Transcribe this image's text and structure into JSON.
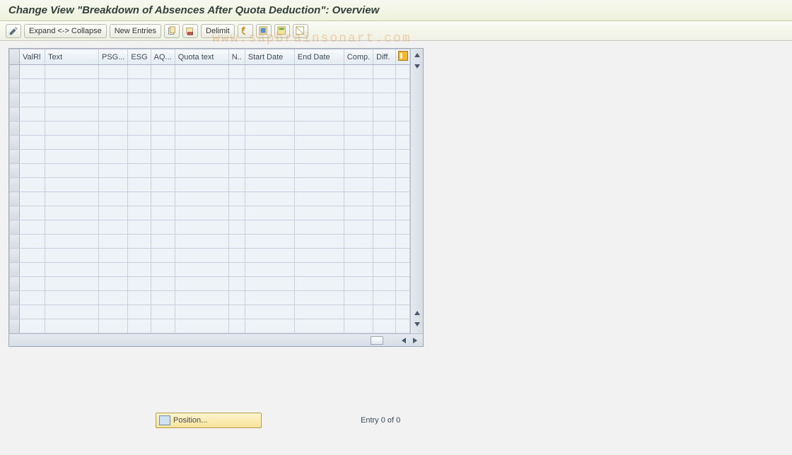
{
  "title": "Change View \"Breakdown of Absences After Quota Deduction\": Overview",
  "toolbar": {
    "expand_collapse": "Expand <-> Collapse",
    "new_entries": "New Entries",
    "delimit": "Delimit"
  },
  "columns": {
    "rowhdr": "",
    "valrl": "ValRl",
    "text": "Text",
    "psg": "PSG...",
    "esg": "ESG",
    "aq": "AQ...",
    "quota_text": "Quota text",
    "n": "N..",
    "start_date": "Start Date",
    "end_date": "End Date",
    "comp": "Comp.",
    "diff": "Diff."
  },
  "row_count": 19,
  "footer": {
    "position_label": "Position...",
    "entry_text": "Entry 0 of 0"
  },
  "watermark": "www.sapbrainsonart.com"
}
